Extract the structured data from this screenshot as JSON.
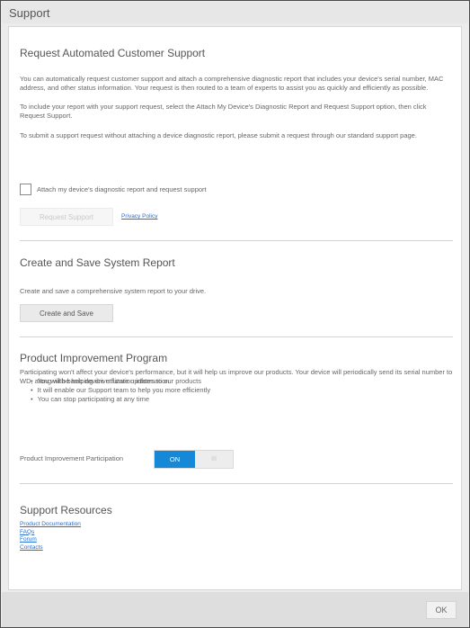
{
  "window": {
    "title": "Support"
  },
  "automated": {
    "title": "Request Automated Customer Support",
    "para1": "You can automatically request customer support and attach a comprehensive diagnostic report that includes your device's serial number, MAC address, and other status information. Your request is then routed to a team of experts to assist you as quickly and efficiently as possible.",
    "para2": "To include your report with your support request, select the Attach My Device's Diagnostic Report and Request Support option, then click Request Support.",
    "para3": "To submit a support request without attaching a device diagnostic report, please submit a request through our standard support page.",
    "checkbox_label": "Attach my device's diagnostic report and request support",
    "checkbox_checked": false,
    "request_button": "Request Support",
    "privacy_link": "Privacy Policy"
  },
  "system_report": {
    "title": "Create and Save System Report",
    "description": "Create and save a comprehensive system report to your drive.",
    "button": "Create and Save"
  },
  "improvement": {
    "title": "Product Improvement Program",
    "description": "Participating won't affect your device's performance, but it will help us improve our products. Your device will periodically send its serial number to WD, along with basic device utilization information.",
    "bullets": [
      "You will be helping drive future updates to our products",
      "It will enable our Support team to help you more efficiently",
      "You can stop participating at any time"
    ],
    "toggle_label": "Product Improvement Participation",
    "toggle_on": "ON",
    "toggle_off": "III",
    "toggle_state": "on",
    "accent_color": "#1588d8"
  },
  "resources": {
    "title": "Support Resources",
    "links": [
      "Product Documentation",
      "FAQs",
      "Forum",
      "Contacts"
    ]
  },
  "footer": {
    "ok_button": "OK"
  }
}
